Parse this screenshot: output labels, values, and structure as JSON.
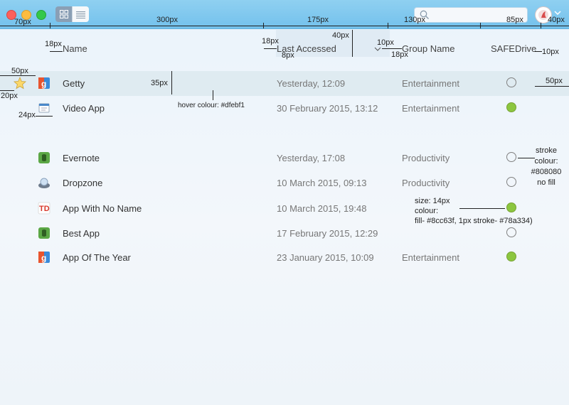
{
  "titlebar": {
    "view_grid_icon": "grid-icon",
    "view_list_icon": "list-icon",
    "search_icon": "search-icon",
    "avatar_icon": "avatar-icon",
    "chevron_icon": "chevron-down-icon"
  },
  "columns": {
    "name": "Name",
    "last_accessed": "Last Accessed",
    "group": "Group Name",
    "safedrive": "SAFEDrive"
  },
  "rows": [
    {
      "name": "Getty",
      "date": "Yesterday, 12:09",
      "group": "Entertainment",
      "safedrive": false,
      "favorite": true,
      "hover": true,
      "icon": "getty"
    },
    {
      "name": "Video App",
      "date": "30 February 2015, 13:12",
      "group": "Entertainment",
      "safedrive": true,
      "icon": "video"
    },
    {
      "name": "Evernote",
      "date": "Yesterday, 17:08",
      "group": "Productivity",
      "safedrive": false,
      "icon": "evernote"
    },
    {
      "name": "Dropzone",
      "date": "10 March 2015, 09:13",
      "group": "Productivity",
      "safedrive": false,
      "icon": "dropzone"
    },
    {
      "name": "App With No Name",
      "date": "10 March 2015, 19:48",
      "group": "",
      "safedrive": true,
      "icon": "td"
    },
    {
      "name": "Best App",
      "date": "17 February 2015, 12:29",
      "group": "",
      "safedrive": false,
      "icon": "evernote"
    },
    {
      "name": "App Of The Year",
      "date": "23 January 2015, 10:09",
      "group": "Entertainment",
      "safedrive": true,
      "icon": "getty"
    }
  ],
  "annotations": {
    "w70": "70px",
    "w300": "300px",
    "w175": "175px",
    "w130": "130px",
    "w85": "85px",
    "w40": "40px",
    "name_pad": "18px",
    "la_pad": "18px",
    "la_8": "8px",
    "h40": "40px",
    "g10": "10px",
    "g18": "18px",
    "sd10": "10px",
    "r50": "50px",
    "r20": "20px",
    "r24": "24px",
    "rh35": "35px",
    "rr50": "50px",
    "hover": "hover colour: #dfebf1",
    "stroke1": "stroke",
    "stroke2": "colour:",
    "stroke3": "#808080",
    "stroke4": "no fill",
    "size1": "size: 14px",
    "size2": "colour:",
    "size3": "fill- #8cc63f,  1px stroke- #78a334)"
  },
  "colors": {
    "hover": "#dfebf1",
    "dot_fill": "#8cc63f",
    "dot_stroke": "#78a334",
    "empty_stroke": "#808080"
  }
}
